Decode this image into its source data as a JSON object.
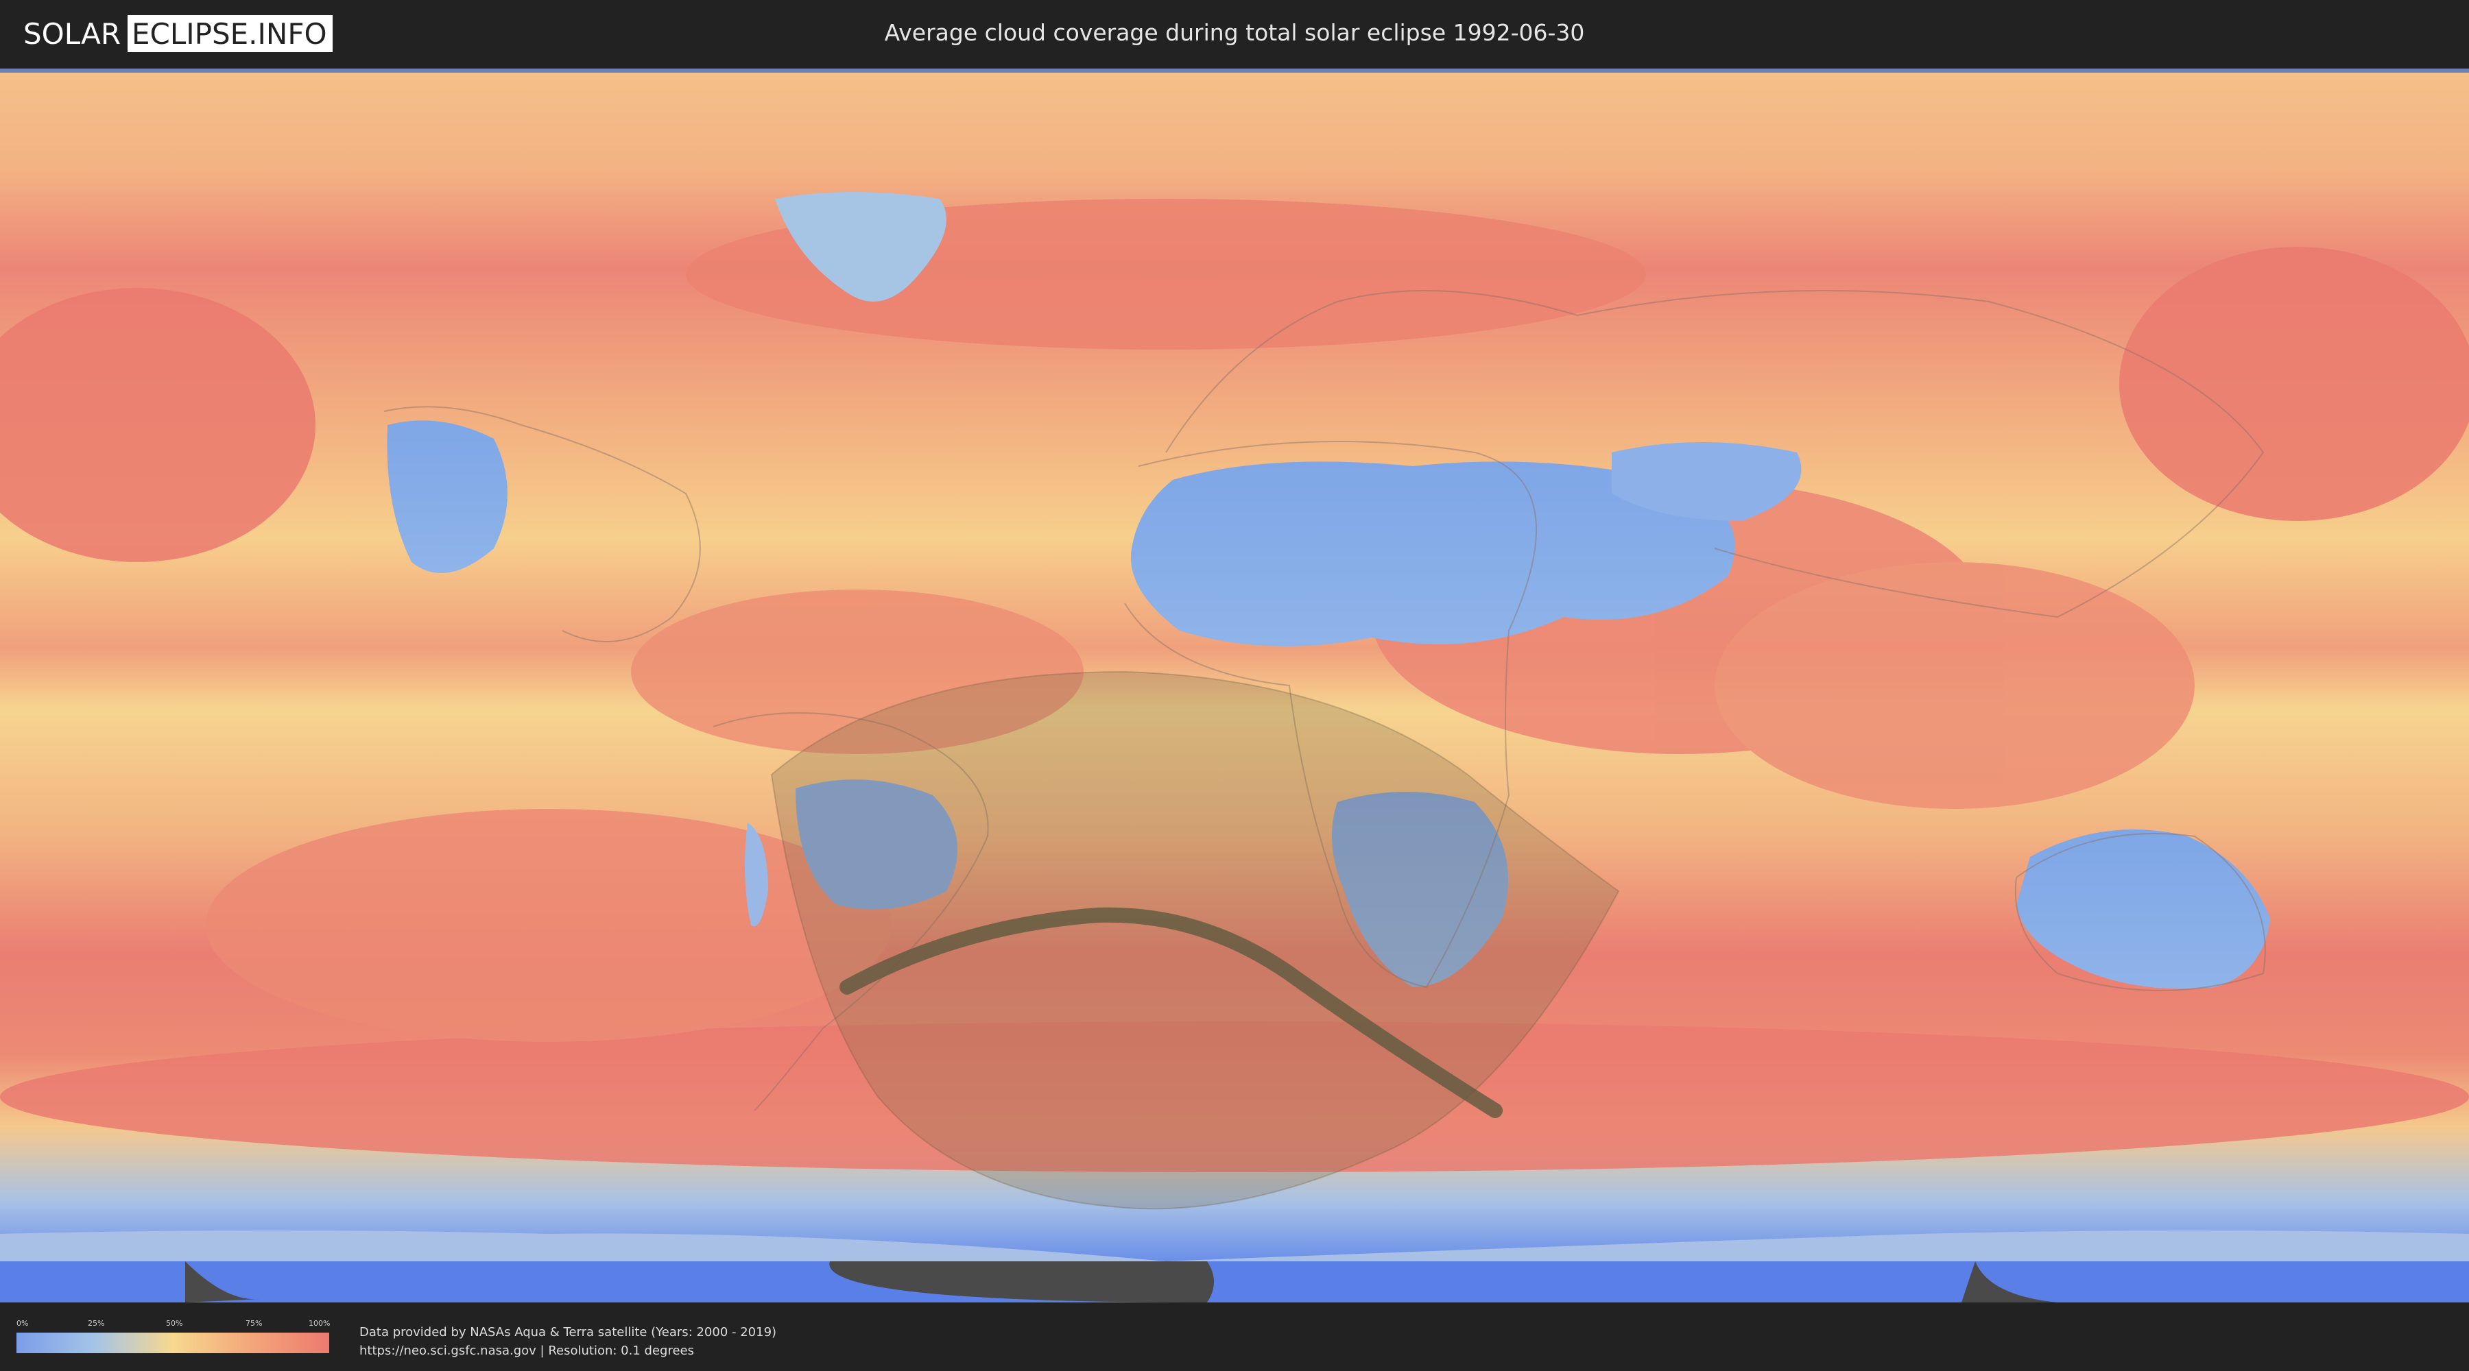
{
  "header": {
    "logo_left": "SOLAR",
    "logo_right": "ECLIPSE.INFO",
    "title": "Average cloud coverage during total solar eclipse 1992-06-30"
  },
  "map": {
    "map_type": "equirectangular cloud coverage",
    "eclipse_date": "1992-06-30",
    "colors": {
      "low": "#6b8fe6",
      "mid": "#f7d68a",
      "high": "#ec7a6e",
      "ocean_pole": "#5f80e8",
      "path": "#5e5a3e",
      "shadow": "#7e6a48"
    }
  },
  "legend": {
    "ticks": [
      "0%",
      "25%",
      "50%",
      "75%",
      "100%"
    ],
    "tick_values": [
      0,
      25,
      50,
      75,
      100
    ],
    "colors": [
      "#7b9de8",
      "#a4c4e8",
      "#f7d88e",
      "#f4a67a",
      "#ec7a70"
    ]
  },
  "credits": {
    "line1": "Data provided by NASAs Aqua & Terra satellite (Years: 2000 - 2019)",
    "line2": "https://neo.sci.gsfc.nasa.gov | Resolution: 0.1 degrees"
  }
}
